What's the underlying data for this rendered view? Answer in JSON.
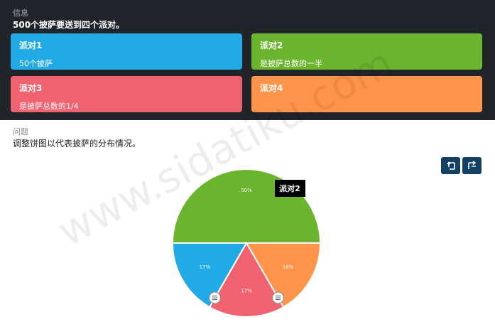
{
  "info": {
    "title": "信息",
    "description": "500个披萨要送到四个派对。"
  },
  "parties": [
    {
      "title": "派对1",
      "description": "50个披萨",
      "color": "#22aae6"
    },
    {
      "title": "派对2",
      "description": "是披萨总数的一半",
      "color": "#6bb42d"
    },
    {
      "title": "派对3",
      "description": "是披萨总数的1/4",
      "color": "#f16270"
    },
    {
      "title": "派对4",
      "description": "",
      "color": "#ff944a"
    }
  ],
  "question": {
    "title": "问题",
    "description": "调整饼图以代表披萨的分布情况。"
  },
  "toolbar": {
    "undo_icon": "undo-icon",
    "redo_icon": "redo-icon"
  },
  "tooltip": {
    "text": "派对2"
  },
  "watermark": "www.sidatiku.com",
  "chart_data": {
    "type": "pie",
    "title": "",
    "slices": [
      {
        "label": "50%",
        "value": 50,
        "color": "#6bb42d"
      },
      {
        "label": "16%",
        "value": 16.67,
        "color": "#ff944a"
      },
      {
        "label": "17%",
        "value": 16.67,
        "color": "#f16270"
      },
      {
        "label": "17%",
        "value": 16.67,
        "color": "#22aae6"
      }
    ]
  }
}
